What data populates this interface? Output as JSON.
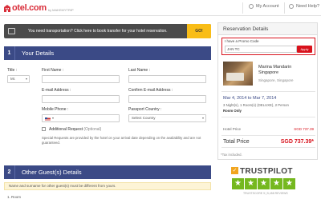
{
  "header": {
    "logo_text": "otel.com",
    "logo_by": "by MAKEMYTRIP",
    "account_label": "My Account",
    "help_label": "Need Help?"
  },
  "transport": {
    "text": "You need transportation? Click here to book transfer for your hotel reservation.",
    "go_label": "GO!"
  },
  "section1": {
    "number": "1",
    "title": "Your Details",
    "title_label": "Title :",
    "title_value": "Mr.",
    "first_name_label": "First Name :",
    "last_name_label": "Last Name :",
    "email_label": "E-mail Address :",
    "confirm_email_label": "Confirm E-mail Address :",
    "mobile_label": "Mobile Phone :",
    "country_label": "Passport Country :",
    "country_placeholder": "Select Country",
    "additional_label": "Additional Request",
    "optional_label": "(Optional)",
    "note": "Special Requests are provided by the hotel on your arrival date depending on the availability and are not guaranteed."
  },
  "section2": {
    "number": "2",
    "title": "Other Guest(s) Details",
    "notice": "Name and surname for other guest(s) must be different from yours.",
    "room_label": "1. Room"
  },
  "reservation": {
    "header": "Reservation Details",
    "promo_label": "I have a Promo Code",
    "promo_value": "JAN TC",
    "apply_label": "Apply",
    "hotel_name_1": "Marina Mandarin",
    "hotel_name_2": "Singapore",
    "hotel_city": "Singapore, Singapore",
    "dates": "Mar 4, 2014 to Mar 7, 2014",
    "nights_info": "3 Night(s), 1 Room(s) (DELUXE), 2 Person",
    "room_only": "Room Only",
    "hotel_price_label": "Hotel Price",
    "hotel_price_value": "SGD 737.39",
    "total_label": "Total Price",
    "total_value": "SGD 737.39*",
    "tax_note": "*Tax included."
  },
  "trustpilot": {
    "title": "TRUSTPILOT",
    "check": "✓",
    "stars": [
      "★",
      "★",
      "★",
      "★",
      "★"
    ],
    "sub": "TRUSTSCORE 9  |  5,458 REVIEWS"
  },
  "colors": {
    "brand": "#d92e3a",
    "section_header": "#3b4a86",
    "go_button": "#f9bd17",
    "apply_button": "#d8121c",
    "trust_green": "#75b81f"
  }
}
